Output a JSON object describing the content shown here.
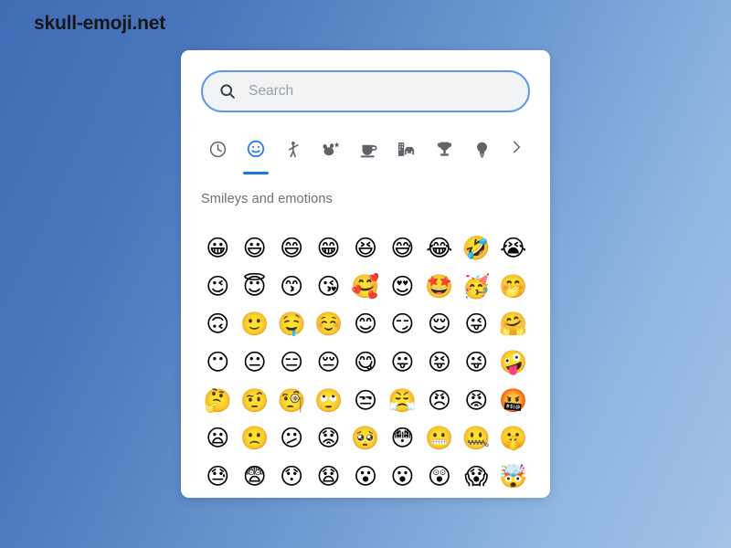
{
  "site": {
    "title": "skull-emoji.net"
  },
  "picker": {
    "search": {
      "placeholder": "Search",
      "value": "",
      "icon": "search-icon",
      "border_color": "#5b96e8",
      "fill_color": "#f1f3f4"
    },
    "tabs": {
      "active_index": 1,
      "accent_color": "#1a73e8",
      "inactive_color": "#5f6368",
      "items": [
        {
          "name": "recent",
          "icon": "clock-icon",
          "label": "Recently used"
        },
        {
          "name": "smileys",
          "icon": "smiley-icon",
          "label": "Smileys and emotions"
        },
        {
          "name": "people",
          "icon": "person-icon",
          "label": "People"
        },
        {
          "name": "nature",
          "icon": "nature-icon",
          "label": "Animals and nature"
        },
        {
          "name": "food",
          "icon": "food-drink-icon",
          "label": "Food and drink"
        },
        {
          "name": "travel",
          "icon": "travel-icon",
          "label": "Travel and places"
        },
        {
          "name": "activities",
          "icon": "trophy-icon",
          "label": "Activities"
        },
        {
          "name": "objects",
          "icon": "lightbulb-icon",
          "label": "Objects"
        }
      ],
      "more": {
        "name": "more-categories",
        "icon": "chevron-right-icon"
      }
    },
    "section": {
      "label": "Smileys and emotions"
    },
    "grid": {
      "columns": 9,
      "rows": [
        [
          "😀",
          "😃",
          "😄",
          "😁",
          "😆",
          "😅",
          "😂",
          "🤣",
          "😭"
        ],
        [
          "😉",
          "😇",
          "😙",
          "😘",
          "🥰",
          "😍",
          "🤩",
          "🥳",
          "🤭"
        ],
        [
          "🙃",
          "🙂",
          "🤤",
          "☺️",
          "😊",
          "😏",
          "😌",
          "😜",
          "🤗"
        ],
        [
          "😶",
          "😐",
          "😑",
          "😔",
          "😋",
          "😛",
          "😝",
          "😜",
          "🤪"
        ],
        [
          "🤔",
          "🤨",
          "🧐",
          "🙄",
          "😒",
          "😤",
          "😠",
          "😡",
          "🤬"
        ],
        [
          "😦",
          "🙁",
          "😕",
          "😟",
          "🥺",
          "😳",
          "😬",
          "🤐",
          "🤫"
        ],
        [
          "😓",
          "😨",
          "😯",
          "😧",
          "😮",
          "😮",
          "😲",
          "😱",
          "🤯"
        ]
      ]
    }
  }
}
